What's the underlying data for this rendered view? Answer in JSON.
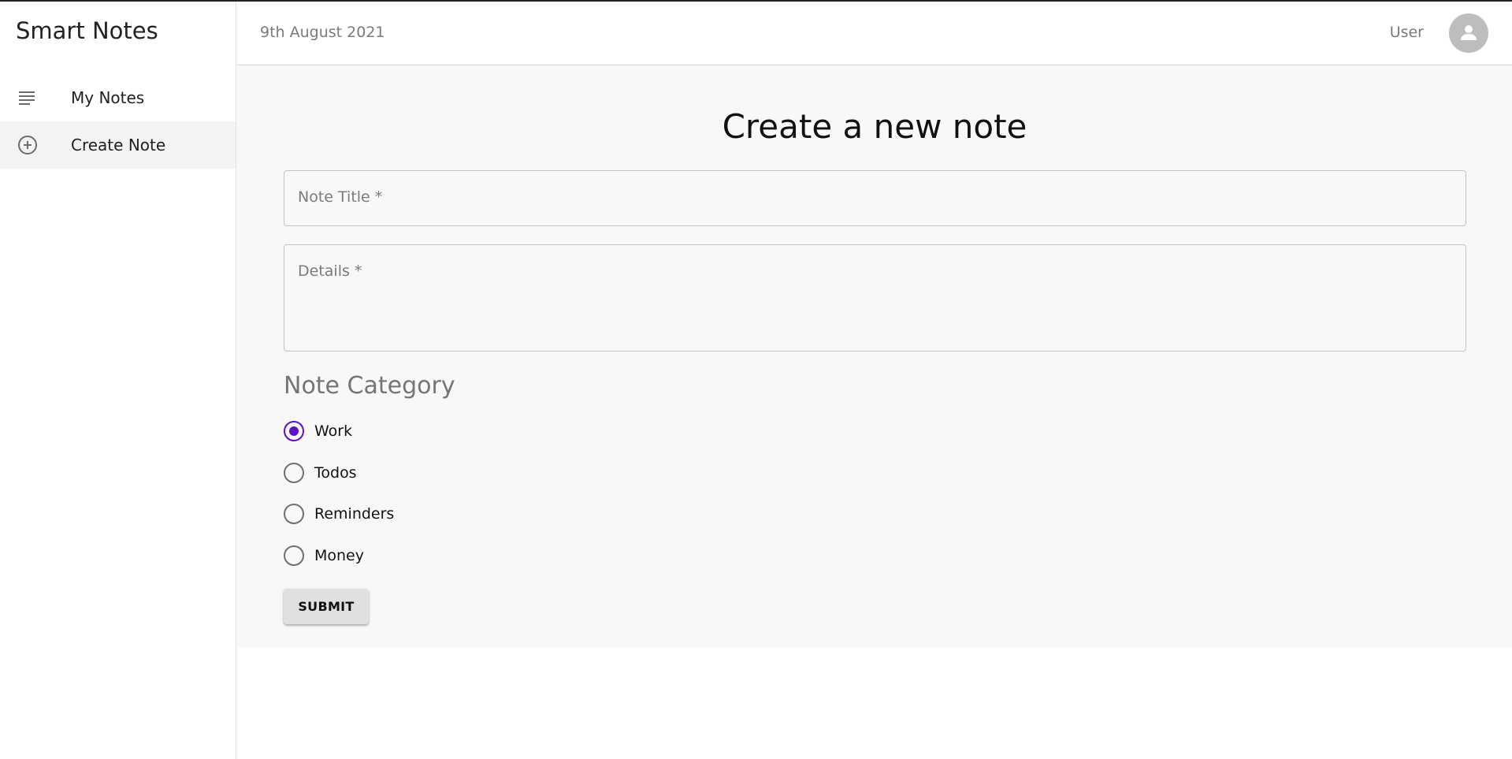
{
  "app": {
    "title": "Smart Notes"
  },
  "sidebar": {
    "items": [
      {
        "label": "My Notes",
        "icon": "notes-list-icon"
      },
      {
        "label": "Create Note",
        "icon": "add-circle-icon"
      }
    ]
  },
  "header": {
    "date": "9th August 2021",
    "user": "User",
    "avatar_icon": "account-avatar-icon"
  },
  "form": {
    "title": "Create a new note",
    "note_title_label": "Note Title *",
    "details_label": "Details *",
    "category_heading": "Note Category",
    "categories": [
      "Work",
      "Todos",
      "Reminders",
      "Money"
    ],
    "selected_category": "Work",
    "submit_label": "SUBMIT"
  },
  "colors": {
    "accent": "#5e12c8",
    "content_bg": "#f8f8f8",
    "muted_text": "#7a7a7a"
  }
}
